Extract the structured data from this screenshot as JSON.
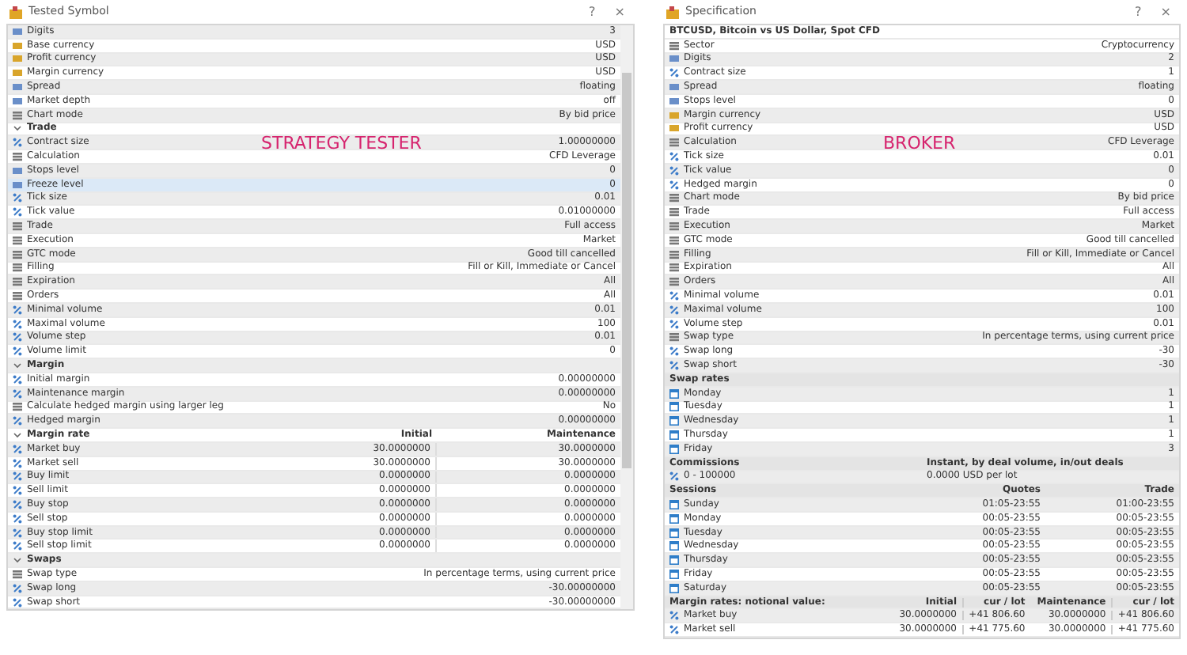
{
  "tester": {
    "title": "Tested Symbol",
    "help": "?",
    "close": "×",
    "label": "STRATEGY TESTER",
    "columns": {
      "initial": "Initial",
      "maintenance": "Maintenance"
    },
    "rows": [
      {
        "kind": "number",
        "name": "Digits",
        "value": "3",
        "selected": false
      },
      {
        "kind": "currency",
        "name": "Base currency",
        "value": "USD",
        "selected": false
      },
      {
        "kind": "currency",
        "name": "Profit currency",
        "value": "USD",
        "selected": false
      },
      {
        "kind": "currency",
        "name": "Margin currency",
        "value": "USD",
        "selected": false
      },
      {
        "kind": "number",
        "name": "Spread",
        "value": "floating",
        "selected": false
      },
      {
        "kind": "number",
        "name": "Market depth",
        "value": "off",
        "selected": false
      },
      {
        "kind": "option",
        "name": "Chart mode",
        "value": "By bid price",
        "selected": false
      },
      {
        "kind": "section",
        "name": "Trade",
        "expanded": true,
        "selected": false
      },
      {
        "kind": "fraction",
        "name": "Contract size",
        "value": "1.00000000",
        "selected": false
      },
      {
        "kind": "option",
        "name": "Calculation",
        "value": "CFD Leverage",
        "selected": false
      },
      {
        "kind": "number",
        "name": "Stops level",
        "value": "0",
        "selected": false
      },
      {
        "kind": "number",
        "name": "Freeze level",
        "value": "0",
        "selected": true
      },
      {
        "kind": "fraction",
        "name": "Tick size",
        "value": "0.01",
        "selected": false
      },
      {
        "kind": "fraction",
        "name": "Tick value",
        "value": "0.01000000",
        "selected": false
      },
      {
        "kind": "option",
        "name": "Trade",
        "value": "Full access",
        "selected": false
      },
      {
        "kind": "option",
        "name": "Execution",
        "value": "Market",
        "selected": false
      },
      {
        "kind": "option",
        "name": "GTC mode",
        "value": "Good till cancelled",
        "selected": false
      },
      {
        "kind": "option",
        "name": "Filling",
        "value": "Fill or Kill, Immediate or Cancel",
        "selected": false
      },
      {
        "kind": "option",
        "name": "Expiration",
        "value": "All",
        "selected": false
      },
      {
        "kind": "option",
        "name": "Orders",
        "value": "All",
        "selected": false
      },
      {
        "kind": "fraction",
        "name": "Minimal volume",
        "value": "0.01",
        "selected": false
      },
      {
        "kind": "fraction",
        "name": "Maximal volume",
        "value": "100",
        "selected": false
      },
      {
        "kind": "fraction",
        "name": "Volume step",
        "value": "0.01",
        "selected": false
      },
      {
        "kind": "fraction",
        "name": "Volume limit",
        "value": "0",
        "selected": false
      },
      {
        "kind": "section",
        "name": "Margin",
        "expanded": true,
        "selected": false
      },
      {
        "kind": "fraction",
        "name": "Initial margin",
        "value": "0.00000000",
        "selected": false
      },
      {
        "kind": "fraction",
        "name": "Maintenance margin",
        "value": "0.00000000",
        "selected": false
      },
      {
        "kind": "option",
        "name": "Calculate hedged margin using larger leg",
        "value": "No",
        "selected": false
      },
      {
        "kind": "fraction",
        "name": "Hedged margin",
        "value": "0.00000000",
        "selected": false
      },
      {
        "kind": "ratehead",
        "name": "Margin rate",
        "expanded": true,
        "selected": false
      },
      {
        "kind": "rate",
        "name": "Market buy",
        "initial": "30.0000000",
        "maintenance": "30.0000000",
        "selected": false
      },
      {
        "kind": "rate",
        "name": "Market sell",
        "initial": "30.0000000",
        "maintenance": "30.0000000",
        "selected": false
      },
      {
        "kind": "rate",
        "name": "Buy limit",
        "initial": "0.0000000",
        "maintenance": "0.0000000",
        "selected": false
      },
      {
        "kind": "rate",
        "name": "Sell limit",
        "initial": "0.0000000",
        "maintenance": "0.0000000",
        "selected": false
      },
      {
        "kind": "rate",
        "name": "Buy stop",
        "initial": "0.0000000",
        "maintenance": "0.0000000",
        "selected": false
      },
      {
        "kind": "rate",
        "name": "Sell stop",
        "initial": "0.0000000",
        "maintenance": "0.0000000",
        "selected": false
      },
      {
        "kind": "rate",
        "name": "Buy stop limit",
        "initial": "0.0000000",
        "maintenance": "0.0000000",
        "selected": false
      },
      {
        "kind": "rate",
        "name": "Sell stop limit",
        "initial": "0.0000000",
        "maintenance": "0.0000000",
        "selected": false
      },
      {
        "kind": "section",
        "name": "Swaps",
        "expanded": true,
        "selected": false
      },
      {
        "kind": "option",
        "name": "Swap type",
        "value": "In percentage terms, using current price",
        "selected": false
      },
      {
        "kind": "fraction",
        "name": "Swap long",
        "value": "-30.00000000",
        "selected": false
      },
      {
        "kind": "fraction",
        "name": "Swap short",
        "value": "-30.00000000",
        "selected": false
      }
    ]
  },
  "spec": {
    "title": "Specification",
    "help": "?",
    "close": "×",
    "label": "BROKER",
    "rows": [
      {
        "kind": "title",
        "cells": [
          "BTCUSD, Bitcoin vs US Dollar, Spot CFD"
        ]
      },
      {
        "kind": "option",
        "cells": [
          "Sector",
          "Cryptocurrency"
        ]
      },
      {
        "kind": "number",
        "cells": [
          "Digits",
          "2"
        ]
      },
      {
        "kind": "fraction",
        "cells": [
          "Contract size",
          "1"
        ]
      },
      {
        "kind": "number",
        "cells": [
          "Spread",
          "floating"
        ]
      },
      {
        "kind": "number",
        "cells": [
          "Stops level",
          "0"
        ]
      },
      {
        "kind": "currency",
        "cells": [
          "Margin currency",
          "USD"
        ]
      },
      {
        "kind": "currency",
        "cells": [
          "Profit currency",
          "USD"
        ]
      },
      {
        "kind": "option",
        "cells": [
          "Calculation",
          "CFD Leverage"
        ]
      },
      {
        "kind": "fraction",
        "cells": [
          "Tick size",
          "0.01"
        ]
      },
      {
        "kind": "fraction",
        "cells": [
          "Tick value",
          "0"
        ]
      },
      {
        "kind": "fraction",
        "cells": [
          "Hedged margin",
          "0"
        ]
      },
      {
        "kind": "option",
        "cells": [
          "Chart mode",
          "By bid price"
        ]
      },
      {
        "kind": "option",
        "cells": [
          "Trade",
          "Full access"
        ]
      },
      {
        "kind": "option",
        "cells": [
          "Execution",
          "Market"
        ]
      },
      {
        "kind": "option",
        "cells": [
          "GTC mode",
          "Good till cancelled"
        ]
      },
      {
        "kind": "option",
        "cells": [
          "Filling",
          "Fill or Kill, Immediate or Cancel"
        ]
      },
      {
        "kind": "option",
        "cells": [
          "Expiration",
          "All"
        ]
      },
      {
        "kind": "option",
        "cells": [
          "Orders",
          "All"
        ]
      },
      {
        "kind": "fraction",
        "cells": [
          "Minimal volume",
          "0.01"
        ]
      },
      {
        "kind": "fraction",
        "cells": [
          "Maximal volume",
          "100"
        ]
      },
      {
        "kind": "fraction",
        "cells": [
          "Volume step",
          "0.01"
        ]
      },
      {
        "kind": "option",
        "cells": [
          "Swap type",
          "In percentage terms, using current price"
        ]
      },
      {
        "kind": "fraction",
        "cells": [
          "Swap long",
          "-30"
        ]
      },
      {
        "kind": "fraction",
        "cells": [
          "Swap short",
          "-30"
        ]
      },
      {
        "kind": "group",
        "cells": [
          "Swap rates"
        ]
      },
      {
        "kind": "day",
        "cells": [
          "Monday",
          "1"
        ]
      },
      {
        "kind": "day",
        "cells": [
          "Tuesday",
          "1"
        ]
      },
      {
        "kind": "day",
        "cells": [
          "Wednesday",
          "1"
        ]
      },
      {
        "kind": "day",
        "cells": [
          "Thursday",
          "1"
        ]
      },
      {
        "kind": "day",
        "cells": [
          "Friday",
          "3"
        ]
      },
      {
        "kind": "group",
        "cells": [
          "Commissions",
          "Instant, by deal volume, in/out deals"
        ]
      },
      {
        "kind": "fraction",
        "cells": [
          "0 - 100000",
          "0.0000 USD per lot"
        ]
      },
      {
        "kind": "group",
        "cells": [
          "Sessions",
          "Quotes",
          "Trade"
        ]
      },
      {
        "kind": "day",
        "cells": [
          "Sunday",
          "01:05-23:55",
          "01:00-23:55"
        ]
      },
      {
        "kind": "day",
        "cells": [
          "Monday",
          "00:05-23:55",
          "00:05-23:55"
        ]
      },
      {
        "kind": "day",
        "cells": [
          "Tuesday",
          "00:05-23:55",
          "00:05-23:55"
        ]
      },
      {
        "kind": "day",
        "cells": [
          "Wednesday",
          "00:05-23:55",
          "00:05-23:55"
        ]
      },
      {
        "kind": "day",
        "cells": [
          "Thursday",
          "00:05-23:55",
          "00:05-23:55"
        ]
      },
      {
        "kind": "day",
        "cells": [
          "Friday",
          "00:05-23:55",
          "00:05-23:55"
        ]
      },
      {
        "kind": "day",
        "cells": [
          "Saturday",
          "00:05-23:55",
          "00:05-23:55"
        ]
      },
      {
        "kind": "group",
        "cells": [
          "Margin rates: notional value:",
          "Initial",
          "cur / lot",
          "Maintenance",
          "cur / lot"
        ]
      },
      {
        "kind": "fraction",
        "cells": [
          "Market buy",
          "30.0000000",
          "+41 806.60",
          "30.0000000",
          "+41 806.60"
        ]
      },
      {
        "kind": "fraction",
        "cells": [
          "Market sell",
          "30.0000000",
          "+41 775.60",
          "30.0000000",
          "+41 775.60"
        ]
      }
    ]
  }
}
